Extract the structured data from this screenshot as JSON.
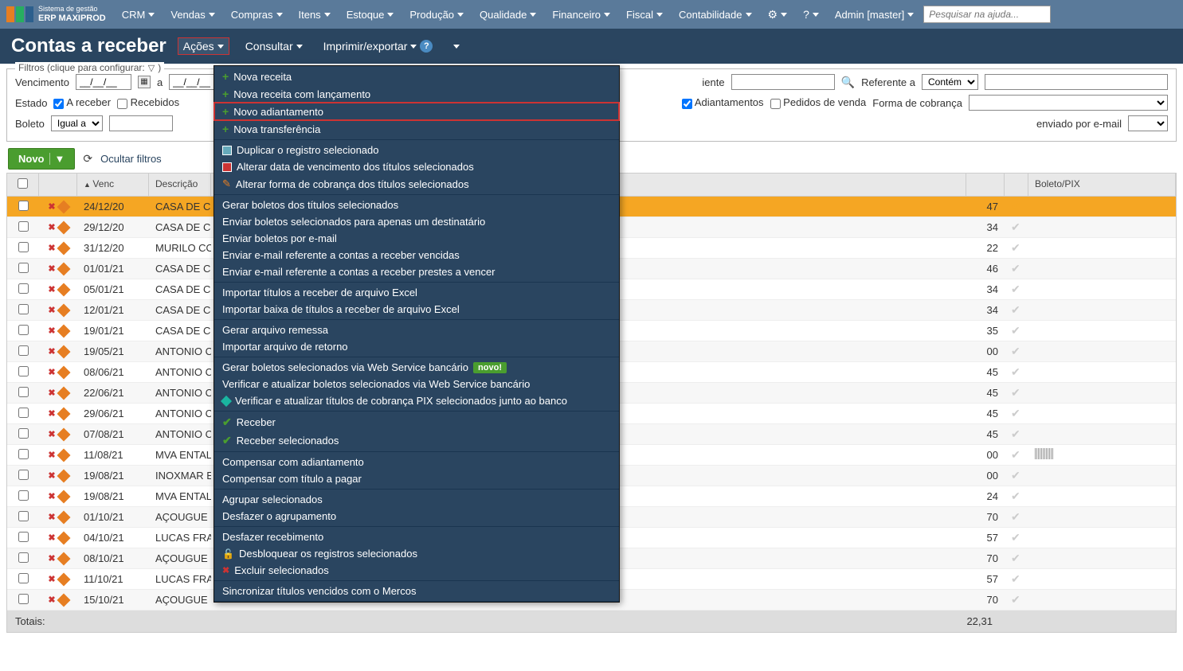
{
  "logo": {
    "line1": "Sistema de gestão",
    "line2": "ERP MAXIPROD"
  },
  "topnav": [
    "CRM",
    "Vendas",
    "Compras",
    "Itens",
    "Estoque",
    "Produção",
    "Qualidade",
    "Financeiro",
    "Fiscal",
    "Contabilidade"
  ],
  "admin_label": "Admin [master]",
  "search_placeholder": "Pesquisar na ajuda...",
  "page_title": "Contas a receber",
  "page_actions": {
    "acoes": "Ações",
    "consultar": "Consultar",
    "imprimir": "Imprimir/exportar"
  },
  "filter_legend": "Filtros (clique para configurar:",
  "filters": {
    "vencimento": "Vencimento",
    "date_ph": "__/__/__",
    "a": "a",
    "iente": "iente",
    "referente_a": "Referente a",
    "contem": "Contém",
    "estado": "Estado",
    "a_receber": "A receber",
    "recebidos": "Recebidos",
    "adiantamentos": "Adiantamentos",
    "pedidos_venda": "Pedidos de venda",
    "forma_cobranca": "Forma de cobrança",
    "boleto": "Boleto",
    "igual_a": "Igual a",
    "enviado_email": "enviado por e-mail"
  },
  "toolbar": {
    "novo": "Novo",
    "ocultar": "Ocultar filtros"
  },
  "columns": {
    "venc": "Venc",
    "descricao": "Descrição",
    "boleto": "Boleto/PIX"
  },
  "rows": [
    {
      "venc": "24/12/20",
      "desc": "CASA DE C",
      "val": "47",
      "checked": true,
      "selected": true
    },
    {
      "venc": "29/12/20",
      "desc": "CASA DE C",
      "val": "34"
    },
    {
      "venc": "31/12/20",
      "desc": "MURILO CO",
      "val": "22"
    },
    {
      "venc": "01/01/21",
      "desc": "CASA DE C",
      "val": "46"
    },
    {
      "venc": "05/01/21",
      "desc": "CASA DE C",
      "val": "34"
    },
    {
      "venc": "12/01/21",
      "desc": "CASA DE C",
      "val": "34"
    },
    {
      "venc": "19/01/21",
      "desc": "CASA DE C",
      "val": "35"
    },
    {
      "venc": "19/05/21",
      "desc": "ANTONIO C",
      "val": "00"
    },
    {
      "venc": "08/06/21",
      "desc": "ANTONIO C",
      "val": "45"
    },
    {
      "venc": "22/06/21",
      "desc": "ANTONIO C",
      "val": "45"
    },
    {
      "venc": "29/06/21",
      "desc": "ANTONIO C",
      "val": "45"
    },
    {
      "venc": "07/08/21",
      "desc": "ANTONIO C",
      "val": "45"
    },
    {
      "venc": "11/08/21",
      "desc": "MVA ENTAL",
      "val": "00",
      "barcode": true
    },
    {
      "venc": "19/08/21",
      "desc": "INOXMAR E",
      "val": "00"
    },
    {
      "venc": "19/08/21",
      "desc": "MVA ENTAL",
      "val": "24"
    },
    {
      "venc": "01/10/21",
      "desc": "AÇOUGUE",
      "val": "70"
    },
    {
      "venc": "04/10/21",
      "desc": "LUCAS FRA",
      "val": "57"
    },
    {
      "venc": "08/10/21",
      "desc": "AÇOUGUE",
      "val": "70"
    },
    {
      "venc": "11/10/21",
      "desc": "LUCAS FRA",
      "val": "57"
    },
    {
      "venc": "15/10/21",
      "desc": "AÇOUGUE",
      "val": "70"
    }
  ],
  "totals": {
    "label": "Totais:",
    "value": "22,31"
  },
  "dropdown": {
    "groups": [
      [
        {
          "icon": "plus",
          "label": "Nova receita"
        },
        {
          "icon": "plus",
          "label": "Nova receita com lançamento"
        },
        {
          "icon": "plus",
          "label": "Novo adiantamento",
          "highlight": true
        },
        {
          "icon": "plus",
          "label": "Nova transferência"
        }
      ],
      [
        {
          "icon": "copy",
          "label": "Duplicar o registro selecionado"
        },
        {
          "icon": "cal",
          "label": "Alterar data de vencimento dos títulos selecionados"
        },
        {
          "icon": "pencil",
          "label": "Alterar forma de cobrança dos títulos selecionados"
        }
      ],
      [
        {
          "label": "Gerar boletos dos títulos selecionados"
        },
        {
          "label": "Enviar boletos selecionados para apenas um destinatário"
        },
        {
          "label": "Enviar boletos por e-mail"
        },
        {
          "label": "Enviar e-mail referente a contas a receber vencidas"
        },
        {
          "label": "Enviar e-mail referente a contas a receber prestes a vencer"
        }
      ],
      [
        {
          "label": "Importar títulos a receber de arquivo Excel"
        },
        {
          "label": "Importar baixa de títulos a receber de arquivo Excel"
        }
      ],
      [
        {
          "label": "Gerar arquivo remessa"
        },
        {
          "label": "Importar arquivo de retorno"
        }
      ],
      [
        {
          "label": "Gerar boletos selecionados via Web Service bancário",
          "badge": "novo!"
        },
        {
          "label": "Verificar e atualizar boletos selecionados via Web Service bancário"
        },
        {
          "icon": "diamond",
          "label": "Verificar e atualizar títulos de cobrança PIX selecionados junto ao banco"
        }
      ],
      [
        {
          "icon": "check",
          "label": "Receber"
        },
        {
          "icon": "check",
          "label": "Receber selecionados"
        }
      ],
      [
        {
          "label": "Compensar com adiantamento"
        },
        {
          "label": "Compensar com título a pagar"
        }
      ],
      [
        {
          "label": "Agrupar selecionados"
        },
        {
          "label": "Desfazer o agrupamento"
        }
      ],
      [
        {
          "label": "Desfazer recebimento"
        },
        {
          "icon": "lock",
          "label": "Desbloquear os registros selecionados"
        },
        {
          "icon": "x",
          "label": "Excluir selecionados"
        }
      ],
      [
        {
          "label": "Sincronizar títulos vencidos com o Mercos"
        }
      ]
    ]
  }
}
